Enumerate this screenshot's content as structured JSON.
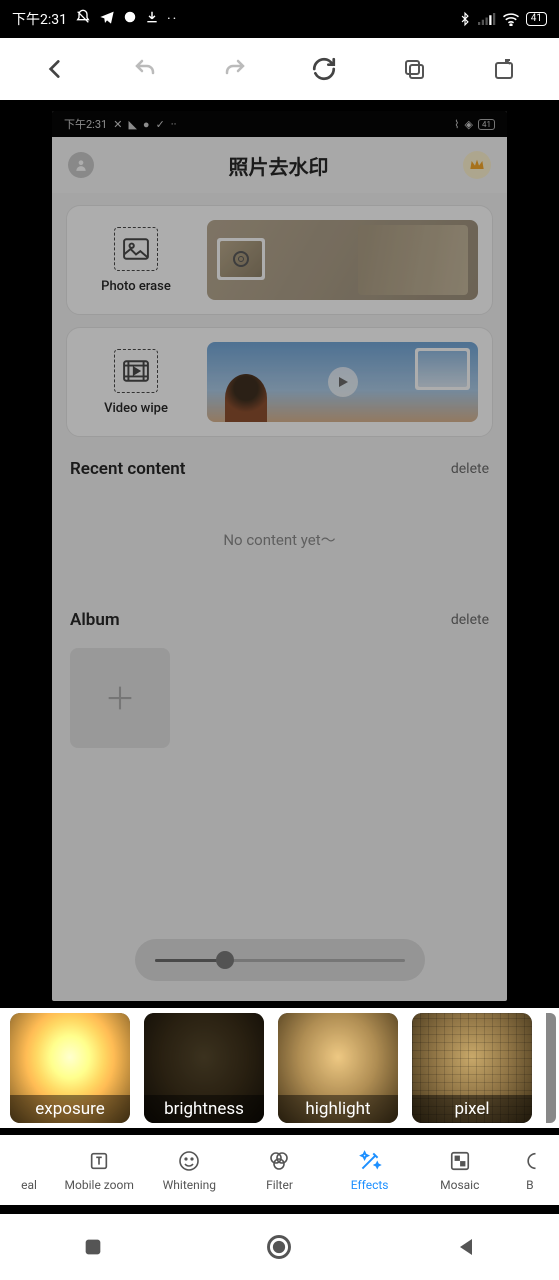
{
  "status_bar": {
    "time": "下午2:31",
    "battery": "41"
  },
  "browser_actions": {
    "back": "back",
    "undo": "undo",
    "redo": "redo",
    "reload": "reload",
    "tabs": "tabs",
    "share": "share"
  },
  "inner": {
    "status_time": "下午2:31",
    "status_battery": "41",
    "title": "照片去水印",
    "card1_label": "Photo erase",
    "card2_label": "Video wipe",
    "recent_title": "Recent content",
    "recent_action": "delete",
    "recent_empty": "No content yet～",
    "album_title": "Album",
    "album_action": "delete",
    "slider_value": 30
  },
  "effects": [
    {
      "id": "exposure",
      "label": "exposure",
      "selected": true
    },
    {
      "id": "brightness",
      "label": "brightness",
      "selected": false
    },
    {
      "id": "highlight",
      "label": "highlight",
      "selected": false
    },
    {
      "id": "pixel",
      "label": "pixel",
      "selected": false
    }
  ],
  "tools": {
    "seal_partial": "eal",
    "zoom": "Mobile zoom",
    "whitening": "Whitening",
    "filter": "Filter",
    "effects": "Effects",
    "mosaic": "Mosaic",
    "b_partial": "B"
  },
  "system_nav": {
    "recent": "recent",
    "home": "home",
    "back": "back"
  }
}
